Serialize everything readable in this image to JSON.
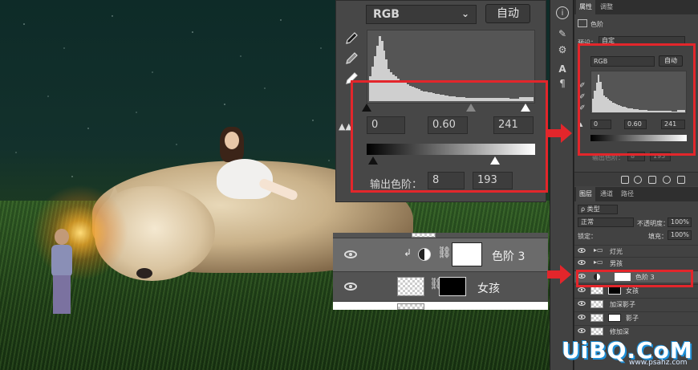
{
  "levels_dialog": {
    "channel": "RGB",
    "auto_label": "自动",
    "input_black": "0",
    "input_mid": "0.60",
    "input_white": "241",
    "output_label": "输出色阶：",
    "output_black": "8",
    "output_white": "193",
    "histogram_peak_fraction": 0.95,
    "input_slider_positions": [
      0,
      0.6,
      0.945
    ],
    "output_slider_positions": [
      0.03,
      0.757
    ]
  },
  "layers_zoom": {
    "row1_name": "色阶 3",
    "row2_name": "女孩"
  },
  "properties_panel": {
    "tab_properties": "属性",
    "tab_adjust": "调整",
    "layer_type": "色阶",
    "preset_label": "预设：",
    "preset_value": "自定",
    "channel": "RGB",
    "auto_label": "自动",
    "in_black": "0",
    "in_mid": "0.60",
    "in_white": "241",
    "out_label": "输出色阶：",
    "out_black": "8",
    "out_white": "193"
  },
  "layers_panel": {
    "tab_layers": "图层",
    "tab_channels": "通道",
    "tab_paths": "路径",
    "filter_label": "ρ 类型",
    "blend_mode": "正常",
    "opacity_label": "不透明度：",
    "opacity_value": "100%",
    "lock_label": "锁定：",
    "fill_label": "填充：",
    "fill_value": "100%",
    "layers": [
      {
        "name": "灯光"
      },
      {
        "name": "男孩"
      },
      {
        "name": "色阶 3"
      },
      {
        "name": "女孩"
      },
      {
        "name": "加深影子"
      },
      {
        "name": "影子"
      },
      {
        "name": "修加深"
      }
    ]
  },
  "watermark": {
    "logo": "UiBQ.CoM",
    "sub": "www.psahz.com"
  },
  "colors": {
    "highlight_red": "#e3262b",
    "panel_bg": "#424242",
    "dialog_bg": "#474747"
  }
}
